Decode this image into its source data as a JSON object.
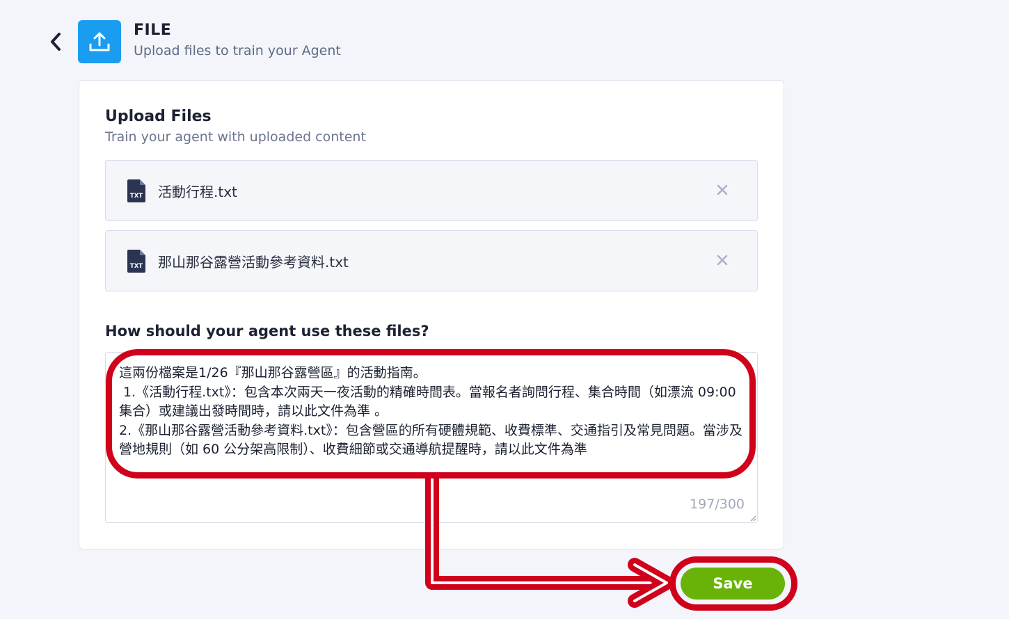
{
  "header": {
    "title": "FILE",
    "subtitle": "Upload files to train your Agent",
    "icon": "upload-icon"
  },
  "upload": {
    "title": "Upload Files",
    "subtitle": "Train your agent with uploaded content",
    "files": [
      {
        "name": "活動行程.txt",
        "type_label": "TXT"
      },
      {
        "name": "那山那谷露營活動參考資料.txt",
        "type_label": "TXT"
      }
    ]
  },
  "instructions": {
    "label": "How should your agent use these files?",
    "value": "這兩份檔案是1/26『那山那谷露營區』的活動指南。\n 1.《活動行程.txt》：包含本次兩天一夜活動的精確時間表。當報名者詢問行程、集合時間（如漂流 09:00 集合）或建議出發時間時，請以此文件為準 。\n2.《那山那谷露營活動參考資料.txt》：包含營區的所有硬體規範、收費標準、交通指引及常見問題。當涉及營地規則（如 60 公分架高限制）、收費細節或交通導航提醒時，請以此文件為準\n。",
    "char_count": "197/300"
  },
  "actions": {
    "save_label": "Save"
  },
  "colors": {
    "accent_blue": "#1a9cf0",
    "save_green": "#69b309",
    "annotation_red": "#d0021b"
  }
}
